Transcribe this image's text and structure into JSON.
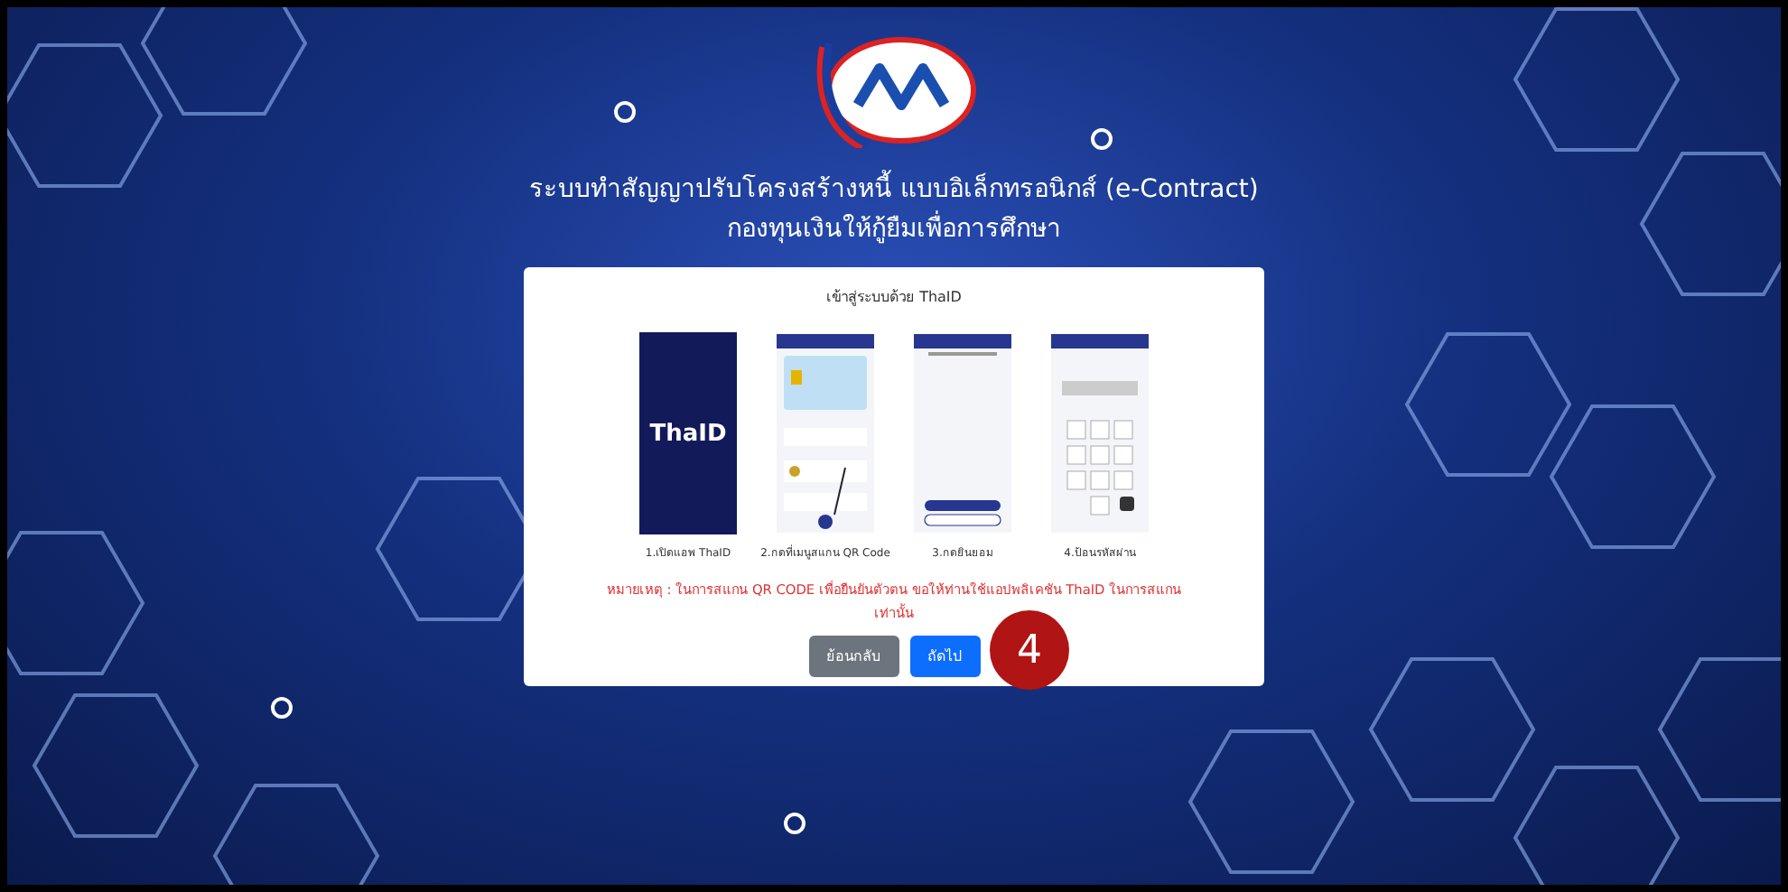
{
  "header": {
    "title_lines": [
      "ระบบทำสัญญาปรับโครงสร้างหนี้ แบบอิเล็กทรอนิกส์ (e-Contract)",
      "กองทุนเงินให้กู้ยืมเพื่อการศึกษา"
    ]
  },
  "card": {
    "heading": "เข้าสู่ระบบด้วย ThaID",
    "steps": [
      {
        "kind": "splash",
        "logo_text": "ThaID",
        "caption": "1.เปิดแอพ ThaID"
      },
      {
        "kind": "card",
        "caption": "2.กดที่เมนูสแกน QR Code"
      },
      {
        "kind": "consent",
        "caption": "3.กดยินยอม"
      },
      {
        "kind": "pin",
        "caption": "4.ป้อนรหัสผ่าน"
      }
    ],
    "note": "หมายเหตุ : ในการสแกน QR CODE เพื่อยืนยันตัวตน ขอให้ท่านใช้แอปพลิเคชัน ThaID ในการสแกนเท่านั้น",
    "buttons": [
      {
        "label": "ย้อนกลับ",
        "kind": "secondary"
      },
      {
        "label": "ถัดไป",
        "kind": "primary"
      }
    ]
  },
  "step_badge": "4"
}
